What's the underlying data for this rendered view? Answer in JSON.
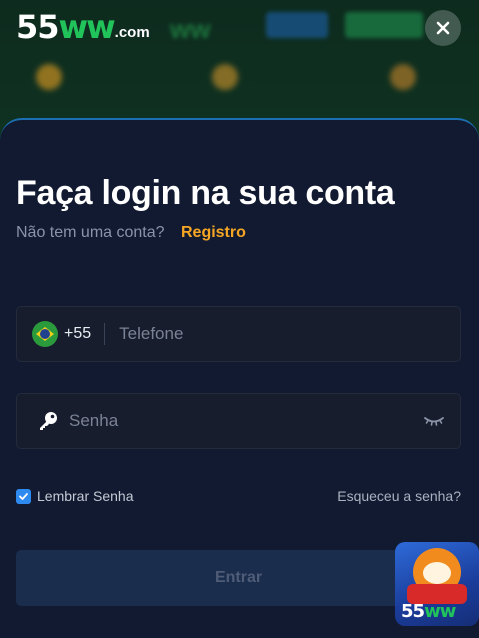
{
  "brand": {
    "logo_number": "55",
    "logo_letters": "ww",
    "logo_suffix": ".com",
    "accent": "#21c45a"
  },
  "modal": {
    "title": "Faça login na sua conta",
    "no_account_text": "Não tem uma conta?",
    "register_link": "Registro",
    "phone": {
      "country_code": "+55",
      "flag_icon": "brazil-flag-icon",
      "placeholder": "Telefone",
      "value": ""
    },
    "password": {
      "icon": "key-icon",
      "placeholder": "Senha",
      "value": "",
      "toggle_icon": "eye-closed-icon"
    },
    "remember_label": "Lembrar Senha",
    "remember_checked": true,
    "forgot_link": "Esqueceu a senha?",
    "submit_label": "Entrar",
    "close_icon": "close-icon"
  },
  "badge": {
    "number": "55",
    "letters": "ww"
  },
  "colors": {
    "sheet_bg": "#111a31",
    "link_orange": "#f5a623",
    "checkbox_blue": "#2f8af0"
  }
}
